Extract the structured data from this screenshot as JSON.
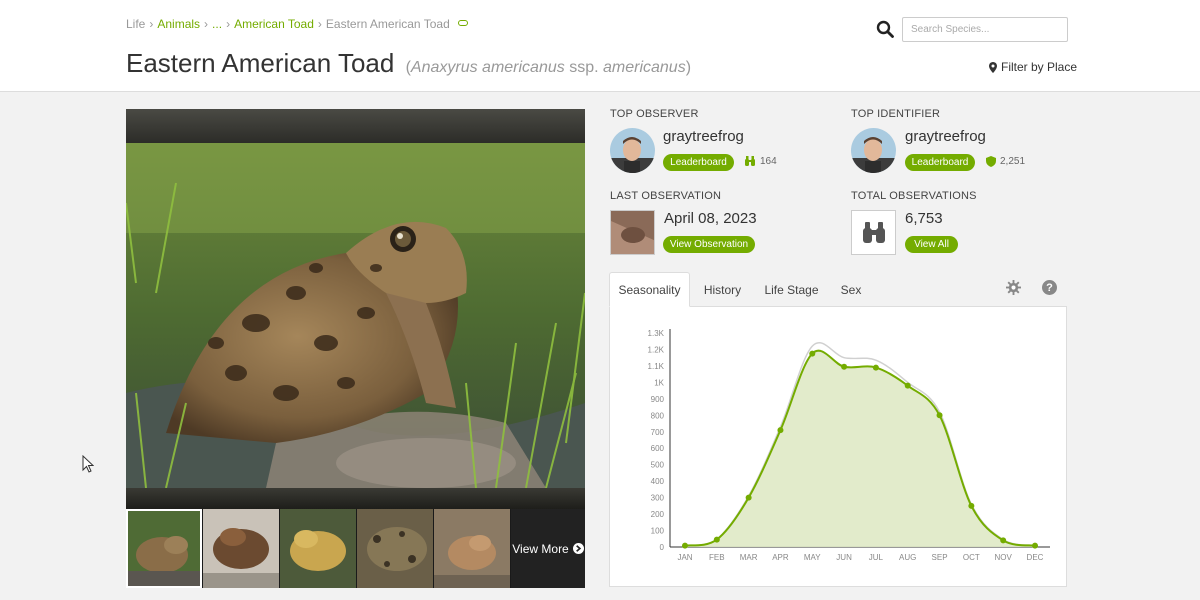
{
  "breadcrumb": {
    "items": [
      "Life",
      "Animals",
      "...",
      "American Toad"
    ],
    "current": "Eastern American Toad",
    "separator": "›"
  },
  "title": {
    "common_name": "Eastern American Toad",
    "open_paren": "(",
    "scientific_genus_species": "Anaxyrus americanus",
    "rank": "ssp.",
    "subspecies": "americanus",
    "close_paren": ")"
  },
  "search": {
    "placeholder": "Search Species..."
  },
  "filter": {
    "label": "Filter by Place"
  },
  "photos": {
    "view_more_label": "View More"
  },
  "top_observer": {
    "heading": "TOP OBSERVER",
    "username": "graytreefrog",
    "button_label": "Leaderboard",
    "count": "164"
  },
  "top_identifier": {
    "heading": "TOP IDENTIFIER",
    "username": "graytreefrog",
    "button_label": "Leaderboard",
    "count": "2,251"
  },
  "last_observation": {
    "heading": "LAST OBSERVATION",
    "date": "April 08, 2023",
    "button_label": "View Observation"
  },
  "total_observations": {
    "heading": "TOTAL OBSERVATIONS",
    "count": "6,753",
    "button_label": "View All"
  },
  "tabs": [
    {
      "label": "Seasonality",
      "active": true
    },
    {
      "label": "History",
      "active": false
    },
    {
      "label": "Life Stage",
      "active": false
    },
    {
      "label": "Sex",
      "active": false
    }
  ],
  "colors": {
    "accent": "#74ac00",
    "accent_fill": "#dfe9c5",
    "secondary_line": "#d0d0d0"
  },
  "icons": [
    "search-icon",
    "map-pin-icon",
    "link-icon",
    "binoculars-icon",
    "shield-icon",
    "gear-icon",
    "help-icon",
    "arrow-circle-right-icon",
    "cursor-icon"
  ],
  "chart_data": {
    "type": "area",
    "categories": [
      "JAN",
      "FEB",
      "MAR",
      "APR",
      "MAY",
      "JUN",
      "JUL",
      "AUG",
      "SEP",
      "OCT",
      "NOV",
      "DEC"
    ],
    "y_ticks": [
      "0",
      "100",
      "200",
      "300",
      "400",
      "500",
      "600",
      "700",
      "800",
      "900",
      "1K",
      "1.1K",
      "1.2K",
      "1.3K"
    ],
    "ylim": [
      0,
      1300
    ],
    "grid": false,
    "series": [
      {
        "values": [
          8,
          45,
          300,
          710,
          1175,
          1095,
          1090,
          980,
          800,
          250,
          40,
          8
        ],
        "style": "filled-markers"
      },
      {
        "values": [
          8,
          48,
          310,
          730,
          1220,
          1150,
          1135,
          1000,
          820,
          260,
          45,
          9
        ],
        "style": "line"
      }
    ]
  }
}
